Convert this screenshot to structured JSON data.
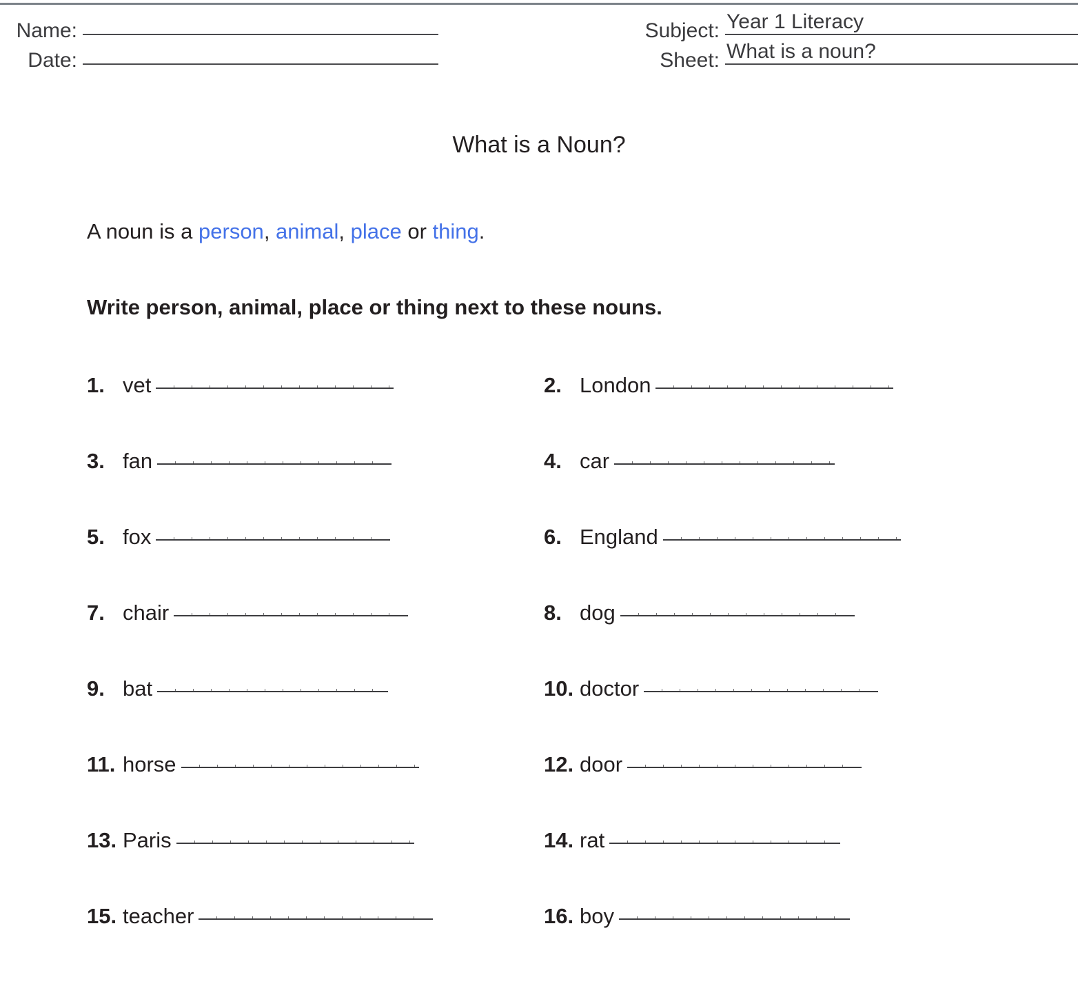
{
  "header": {
    "name_label": "Name:",
    "name_value": "",
    "date_label": "Date:",
    "date_value": "",
    "subject_label": "Subject:",
    "subject_value": "Year 1 Literacy",
    "sheet_label": "Sheet:",
    "sheet_value": "What is a noun?"
  },
  "title": "What is a Noun?",
  "definition": {
    "prefix": "A noun is a ",
    "kw1": "person",
    "sep1": ", ",
    "kw2": "animal",
    "sep2": ", ",
    "kw3": "place",
    "sep3": " or ",
    "kw4": "thing",
    "suffix": "."
  },
  "instruction": "Write person, animal, place or thing next to these nouns.",
  "accent_color": "#4472e8",
  "questions": [
    {
      "number": "1.",
      "word": "vet"
    },
    {
      "number": "2.",
      "word": "London"
    },
    {
      "number": "3.",
      "word": "fan"
    },
    {
      "number": "4.",
      "word": "car"
    },
    {
      "number": "5.",
      "word": "fox"
    },
    {
      "number": "6.",
      "word": "England"
    },
    {
      "number": "7.",
      "word": "chair"
    },
    {
      "number": "8.",
      "word": "dog"
    },
    {
      "number": "9.",
      "word": "bat"
    },
    {
      "number": "10.",
      "word": "doctor"
    },
    {
      "number": "11.",
      "word": "horse"
    },
    {
      "number": "12.",
      "word": "door"
    },
    {
      "number": "13.",
      "word": "Paris"
    },
    {
      "number": "14.",
      "word": "rat"
    },
    {
      "number": "15.",
      "word": "teacher"
    },
    {
      "number": "16.",
      "word": "boy"
    }
  ]
}
